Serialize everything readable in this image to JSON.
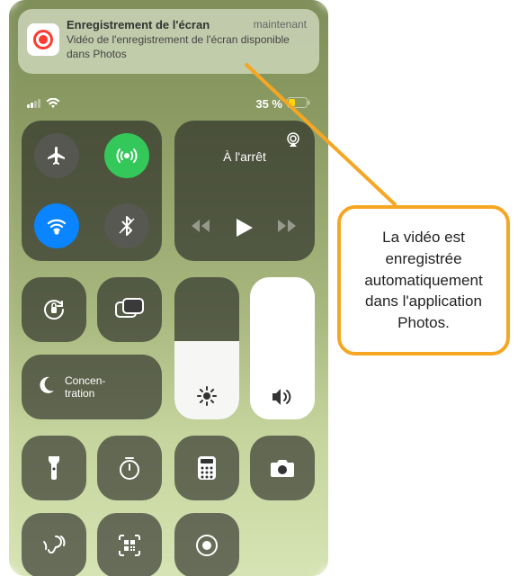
{
  "notification": {
    "title": "Enregistrement de l'écran",
    "time": "maintenant",
    "body": "Vidéo de l'enregistrement de l'écran disponible dans Photos"
  },
  "status": {
    "battery_text": "35 %"
  },
  "media": {
    "title": "À l'arrêt"
  },
  "focus": {
    "label": "Concen-\ntration"
  },
  "sliders": {
    "brightness_percent": 55,
    "volume_percent": 100
  },
  "callout": {
    "text": "La vidéo est enregistrée automatiquement dans l'application Photos."
  }
}
